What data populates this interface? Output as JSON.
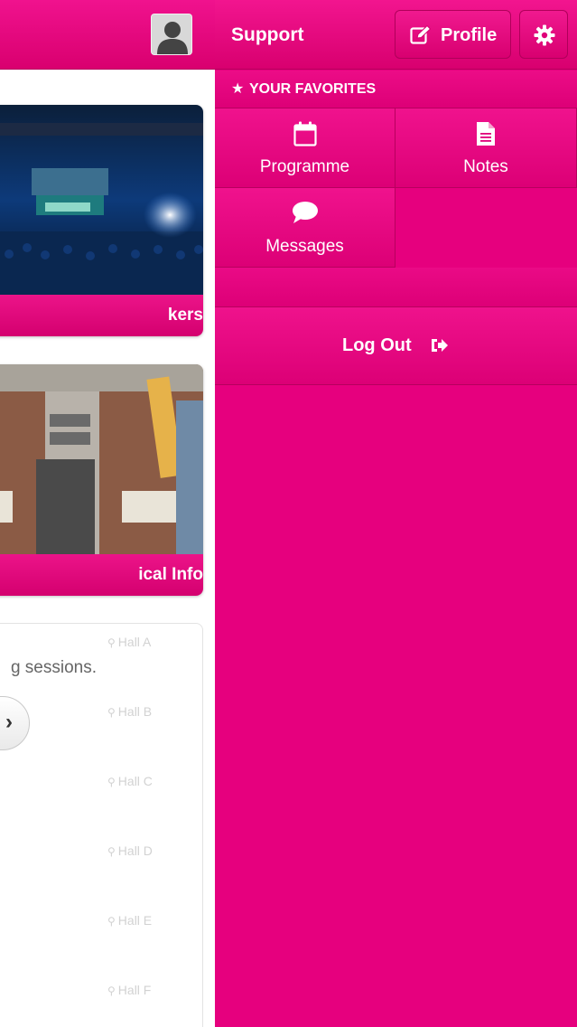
{
  "left": {
    "cards": [
      {
        "label": "kers"
      },
      {
        "label": "ical Info"
      }
    ],
    "sessions": {
      "text": "g sessions.",
      "halls": [
        "Hall A",
        "Hall B",
        "Hall C",
        "Hall D",
        "Hall E",
        "Hall F"
      ]
    }
  },
  "menu": {
    "title": "Support",
    "profile_label": "Profile",
    "favorites_header": "YOUR FAVORITES",
    "tiles": [
      {
        "label": "Programme",
        "icon": "calendar-icon"
      },
      {
        "label": "Notes",
        "icon": "document-icon"
      },
      {
        "label": "Messages",
        "icon": "chat-bubble-icon"
      }
    ],
    "logout_label": "Log Out"
  },
  "colors": {
    "brand": "#e6007e",
    "card_label": "#d4006f"
  }
}
